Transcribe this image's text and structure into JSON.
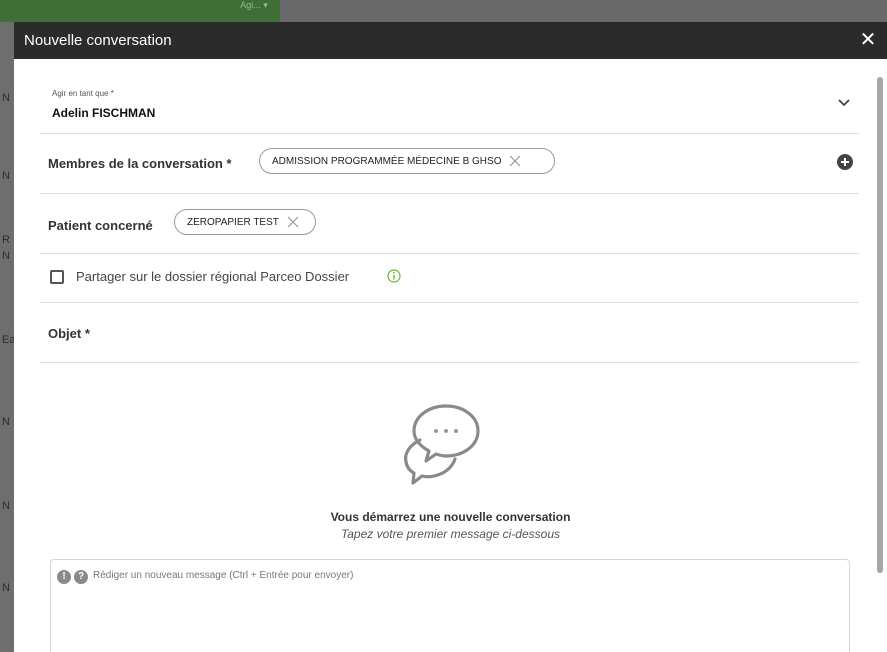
{
  "backdrop": {
    "tab_label": "Agi... ▾",
    "letters": [
      "N",
      "N",
      "R",
      "N",
      "Ea",
      "N",
      "N",
      "N"
    ]
  },
  "modal": {
    "title": "Nouvelle conversation",
    "close_symbol": "✕"
  },
  "act_as": {
    "label": "Agir en tant que *",
    "value": "Adelin FISCHMAN",
    "chevron_icon": "chevron-down-icon"
  },
  "members": {
    "label": "Membres de la conversation *",
    "chips": [
      {
        "text": "ADMISSION PROGRAMMÉE MÉDECINE B GHSO"
      }
    ],
    "add_icon": "plus-circle-icon"
  },
  "patient": {
    "label": "Patient concerné",
    "chip": "ZEROPAPIER TEST"
  },
  "share": {
    "label": "Partager sur le dossier régional Parceo Dossier",
    "checked": false,
    "info_icon": "info-icon",
    "info_color": "#6db33f"
  },
  "object": {
    "label": "Objet *",
    "value": ""
  },
  "empty_state": {
    "icon": "chat-bubbles-icon",
    "title": "Vous démarrez une nouvelle conversation",
    "subtitle": "Tapez votre premier message ci-dessous"
  },
  "composer": {
    "icon_1": "!",
    "icon_2": "?",
    "placeholder": "Rédiger un nouveau message (Ctrl + Entrée pour envoyer)",
    "value": ""
  }
}
